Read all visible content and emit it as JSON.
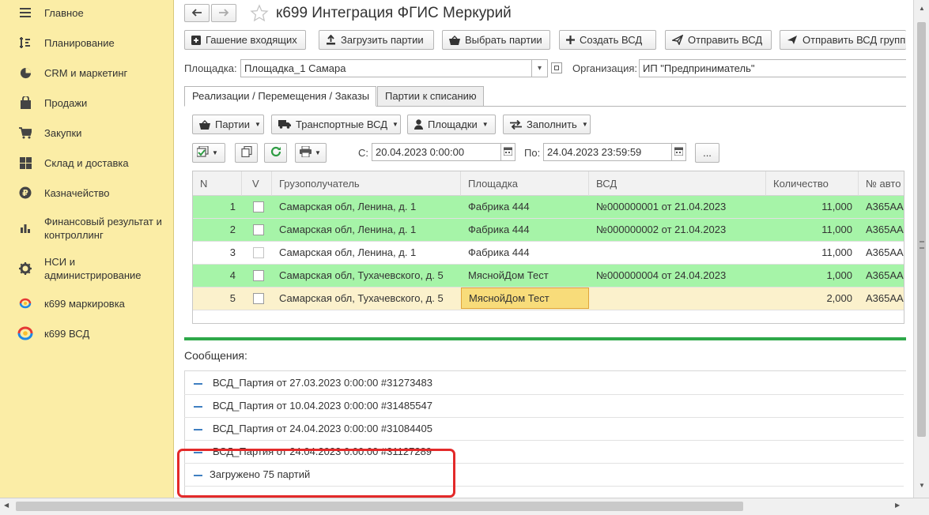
{
  "sidebar": {
    "items": [
      {
        "label": "Главное",
        "icon": "menu-icon"
      },
      {
        "label": "Планирование",
        "icon": "planning-icon"
      },
      {
        "label": "CRM и маркетинг",
        "icon": "pie-chart-icon"
      },
      {
        "label": "Продажи",
        "icon": "shopping-bag-icon"
      },
      {
        "label": "Закупки",
        "icon": "cart-icon"
      },
      {
        "label": "Склад и доставка",
        "icon": "warehouse-icon"
      },
      {
        "label": "Казначейство",
        "icon": "ruble-icon"
      },
      {
        "label": "Финансовый результат и контроллинг",
        "icon": "bar-chart-icon"
      },
      {
        "label": "НСИ и администрирование",
        "icon": "gear-icon"
      },
      {
        "label": "к699 маркировка",
        "icon": "k699-logo-icon"
      },
      {
        "label": "к699 ВСД",
        "icon": "k699-logo-icon"
      }
    ]
  },
  "header": {
    "title": "к699 Интеграция ФГИС Меркурий",
    "back_icon": "arrow-left-icon",
    "forward_icon": "arrow-right-icon",
    "star_icon": "star-icon"
  },
  "toolbar": {
    "buttons": [
      {
        "label": "Гашение входящих",
        "icon": "plus-square-icon"
      },
      {
        "label": "Загрузить партии",
        "icon": "upload-icon"
      },
      {
        "label": "Выбрать партии",
        "icon": "basket-icon"
      },
      {
        "label": "Создать ВСД",
        "icon": "plus-icon"
      },
      {
        "label": "Отправить ВСД",
        "icon": "send-icon"
      },
      {
        "label": "Отправить ВСД групп",
        "icon": "send-icon"
      }
    ]
  },
  "filters": {
    "site_label": "Площадка:",
    "site_value": "Площадка_1 Самара",
    "org_label": "Организация:",
    "org_value": "ИП \"Предприниматель\""
  },
  "tabs": [
    {
      "label": "Реализации / Перемещения / Заказы",
      "active": true
    },
    {
      "label": "Партии к списанию",
      "active": false
    }
  ],
  "subtoolbar": {
    "buttons": [
      {
        "label": "Партии",
        "icon": "basket-icon"
      },
      {
        "label": "Транспортные ВСД",
        "icon": "truck-icon"
      },
      {
        "label": "Площадки",
        "icon": "person-icon"
      },
      {
        "label": "Заполнить",
        "icon": "swap-arrows-icon"
      }
    ]
  },
  "period": {
    "from_label": "С:",
    "from_value": "20.04.2023  0:00:00",
    "to_label": "По:",
    "to_value": "24.04.2023 23:59:59",
    "more_label": "..."
  },
  "table": {
    "columns": [
      "N",
      "V",
      "Грузополучатель",
      "Площадка",
      "ВСД",
      "Количество",
      "№ авто"
    ],
    "rows": [
      {
        "n": "1",
        "consignee": "Самарская обл, Ленина, д. 1",
        "site": "Фабрика 444",
        "vsd": "№000000001 от 21.04.2023",
        "qty": "11,000",
        "auto": "А365АА...",
        "status": "green"
      },
      {
        "n": "2",
        "consignee": "Самарская обл, Ленина, д. 1",
        "site": "Фабрика 444",
        "vsd": "№000000002 от 21.04.2023",
        "qty": "11,000",
        "auto": "А365АА...",
        "status": "green"
      },
      {
        "n": "3",
        "consignee": "Самарская обл, Ленина, д. 1",
        "site": "Фабрика 444",
        "vsd": "",
        "qty": "11,000",
        "auto": "А365АА...",
        "status": "white"
      },
      {
        "n": "4",
        "consignee": "Самарская обл, Тухачевского, д. 5",
        "site": "МяснойДом Тест",
        "vsd": "№000000004 от 24.04.2023",
        "qty": "1,000",
        "auto": "А365АА...",
        "status": "green"
      },
      {
        "n": "5",
        "consignee": "Самарская обл, Тухачевского, д. 5",
        "site": "МяснойДом Тест",
        "vsd": "",
        "qty": "2,000",
        "auto": "А365АА...",
        "status": "selected"
      }
    ]
  },
  "messages": {
    "title": "Сообщения:",
    "items": [
      "ВСД_Партия от 27.03.2023 0:00:00 #31273483",
      "ВСД_Партия от 10.04.2023 0:00:00 #31485547",
      "ВСД_Партия от 24.04.2023 0:00:00 #31084405",
      "ВСД_Партия от 24.04.2023 0:00:00 #31127289",
      "Загружено 75 партий"
    ]
  },
  "colors": {
    "sidebar_bg": "#fbeda6",
    "row_green": "#a6f4a8",
    "row_selected": "#fbf1cc",
    "cell_focus": "#f8dc7a",
    "accent_green": "#2ea84a",
    "annotation_red": "#e32a2a"
  }
}
